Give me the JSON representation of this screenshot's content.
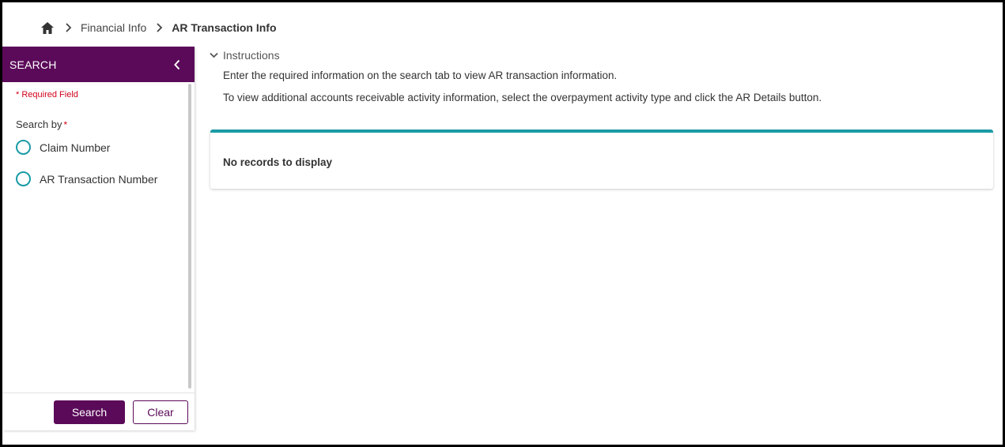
{
  "breadcrumb": {
    "home_icon": "home-icon",
    "items": [
      "Financial Info",
      "AR Transaction Info"
    ]
  },
  "sidebar": {
    "title": "SEARCH",
    "collapse_icon": "chevron-left-icon",
    "required_note": "* Required Field",
    "search_by_label": "Search by",
    "required_marker": "*",
    "options": [
      "Claim Number",
      "AR Transaction Number"
    ],
    "search_button": "Search",
    "clear_button": "Clear"
  },
  "instructions": {
    "toggle_label": "Instructions",
    "lines": [
      "Enter the required information on the search tab to view AR transaction information.",
      "To view additional accounts receivable activity information, select the overpayment activity type and click the AR Details button."
    ]
  },
  "results": {
    "empty_message": "No records to display"
  },
  "colors": {
    "brand_purple": "#5b0a59",
    "accent_teal": "#1a9ba5",
    "required_red": "#d0021b"
  }
}
